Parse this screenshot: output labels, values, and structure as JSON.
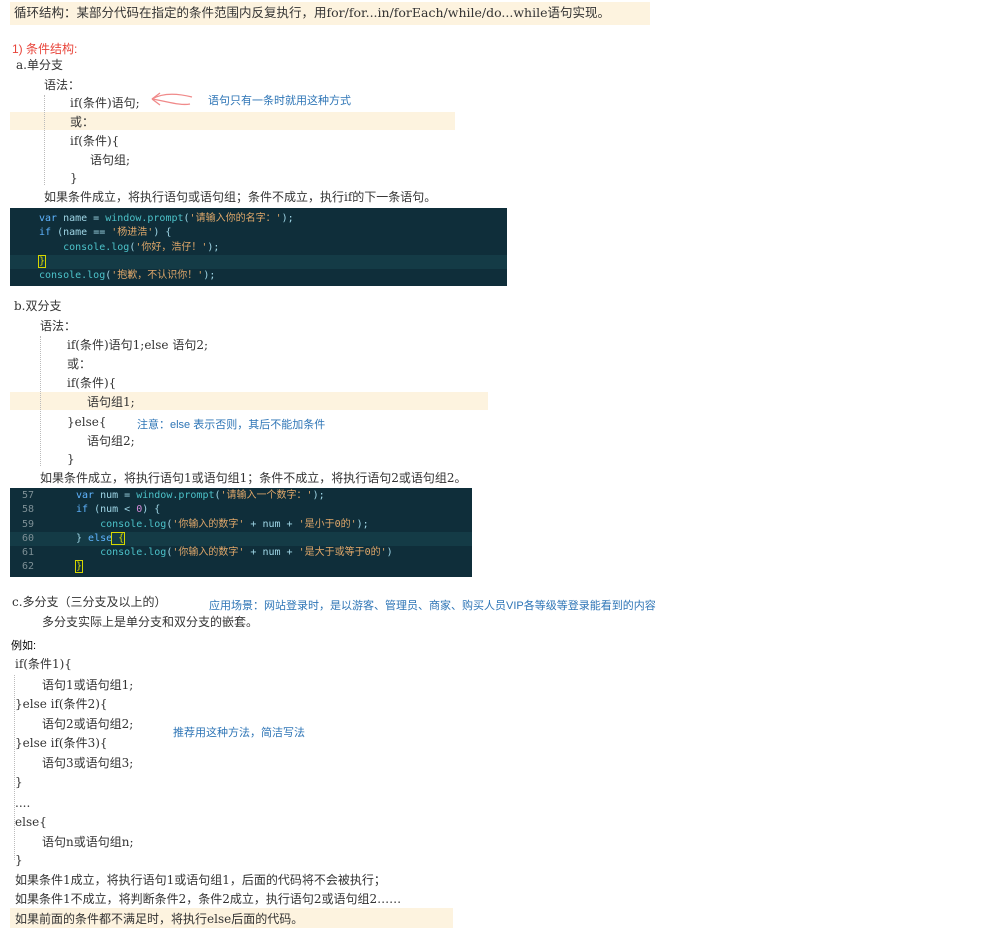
{
  "intro": "循环结构：某部分代码在指定的条件范围内反复执行，用for/for...in/forEach/while/do...while语句实现。",
  "cond_title": "1) 条件结构:",
  "a": {
    "title": "a.单分支",
    "syntax": "语法：",
    "l1": "if(条件)语句;",
    "note": "语句只有一条时就用这种方式",
    "or": "或：",
    "l2": "if(条件){",
    "l3": "语句组;",
    "l4": "}",
    "desc": "如果条件成立，将执行语句或语句组；条件不成立，执行if的下一条语句。"
  },
  "code1": {
    "lines": [
      [
        "var",
        " name = ",
        "window.prompt",
        "(",
        "'请输入你的名字：'",
        ");"
      ],
      [
        "if",
        " (name == ",
        "",
        "",
        "'杨进浩'",
        ") {"
      ],
      [
        "",
        "    ",
        "console.log",
        "(",
        "'你好，浩仔！'",
        ");"
      ],
      [
        "",
        "",
        "",
        "",
        "",
        "}"
      ],
      [
        "",
        "",
        "console.log",
        "(",
        "'抱歉，不认识你！'",
        ");"
      ]
    ]
  },
  "b": {
    "title": "b.双分支",
    "syntax": "语法：",
    "l1": "if(条件)语句1;else 语句2;",
    "or": "或：",
    "l2": "if(条件){",
    "l3": "语句组1;",
    "l4": "}else{",
    "note": "注意：else 表示否则，其后不能加条件",
    "l5": "语句组2;",
    "l6": "}",
    "desc": "如果条件成立，将执行语句1或语句组1；条件不成立，将执行语句2或语句组2。"
  },
  "code2": {
    "line_numbers": [
      "57",
      "58",
      "59",
      "60",
      "61",
      "62"
    ],
    "lines": [
      [
        "var",
        " num = ",
        "window.prompt",
        "(",
        "'请输入一个数字：'",
        ");"
      ],
      [
        "if",
        " (num < ",
        "0",
        ") {",
        "",
        ""
      ],
      [
        "",
        "    ",
        "console.log",
        "(",
        "'你输入的数字'",
        " + num + ",
        "'是小于0的'",
        ");"
      ],
      [
        "",
        "} ",
        "else",
        " {",
        "",
        ""
      ],
      [
        "",
        "    ",
        "console.log",
        "(",
        "'你输入的数字'",
        " + num + ",
        "'是大于或等于0的'",
        ")"
      ],
      [
        "",
        "}",
        "",
        "",
        "",
        ""
      ]
    ]
  },
  "c": {
    "title": "c.多分支（三分支及以上的）",
    "note": "应用场景：网站登录时，是以游客、管理员、商家、购买人员VIP各等级等登录能看到的内容",
    "desc": "多分支实际上是单分支和双分支的嵌套。",
    "example": "例如:",
    "l1": "if(条件1){",
    "l2": "语句1或语句组1;",
    "l3": "}else if(条件2){",
    "l4": "语句2或语句组2;",
    "note2": "推荐用这种方法，简洁写法",
    "l5": "}else if(条件3){",
    "l6": "语句3或语句组3;",
    "l7": "}",
    "l8": "....",
    "l9": "else{",
    "l10": "语句n或语句组n;",
    "l11": "}",
    "d1": "如果条件1成立，将执行语句1或语句组1，后面的代码将不会被执行；",
    "d2": "如果条件1不成立，将判断条件2，条件2成立，执行语句2或语句组2……",
    "d3": "如果前面的条件都不满足时，将执行else后面的代码。"
  }
}
